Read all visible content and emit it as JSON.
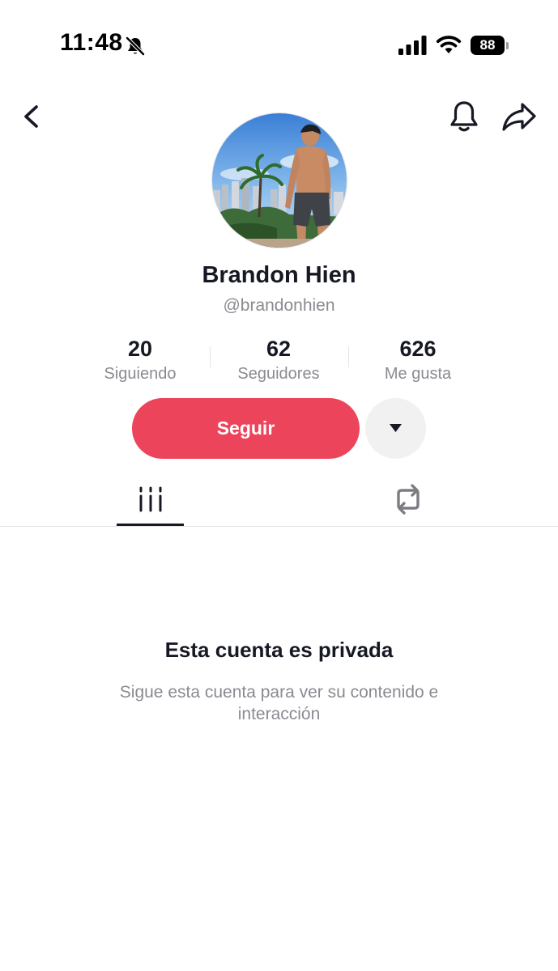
{
  "status_bar": {
    "time": "11:48",
    "battery_level": "88",
    "icons": [
      "bell-off-icon",
      "signal-icon",
      "wifi-icon",
      "battery-icon"
    ]
  },
  "nav": {
    "icons": [
      "back-arrow-icon",
      "notification-bell-icon",
      "share-arrow-icon"
    ]
  },
  "profile": {
    "display_name": "Brandon Hien",
    "username": "@brandonhien"
  },
  "stats": {
    "following_count": "20",
    "following_label": "Siguiendo",
    "followers_count": "62",
    "followers_label": "Seguidores",
    "likes_count": "626",
    "likes_label": "Me gusta"
  },
  "actions": {
    "follow_label": "Seguir"
  },
  "tabs": {
    "items": [
      "videos-grid-icon",
      "reposts-icon"
    ],
    "active_index": 0
  },
  "private_notice": {
    "title": "Esta cuenta es privada",
    "subtitle": "Sigue esta cuenta para ver su contenido e interacción"
  },
  "colors": {
    "follow_button": "#ec445b",
    "text_primary": "#161823",
    "text_secondary": "#8a8b91",
    "divider": "#e3e3e4",
    "more_button_bg": "#f1f1f2"
  }
}
